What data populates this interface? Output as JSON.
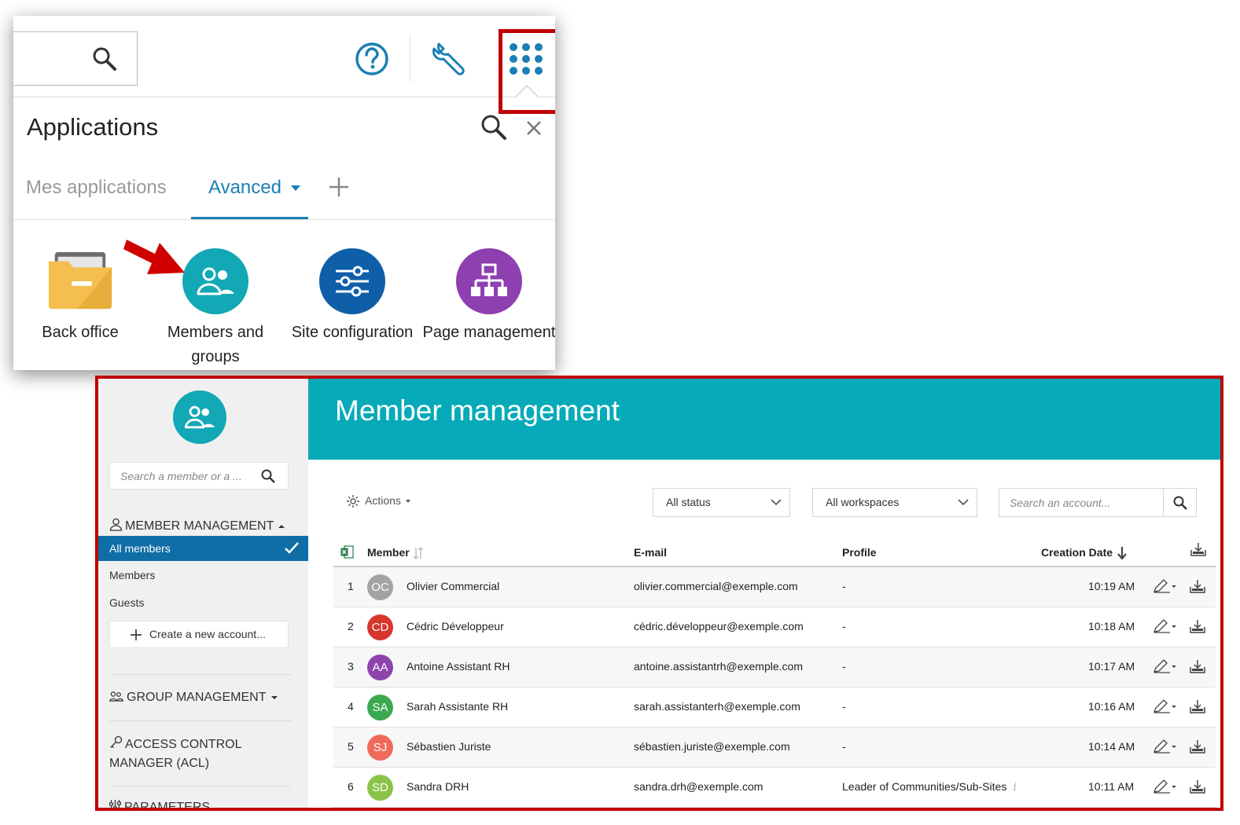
{
  "top_popup": {
    "search_icon": "search-icon",
    "help_icon": "help-circle-icon",
    "tools_icon": "wrench-icon",
    "apps_icon": "apps-grid-icon",
    "title": "Applications",
    "tabs": [
      {
        "label": "Mes applications",
        "active": false
      },
      {
        "label": "Avanced",
        "active": true
      }
    ],
    "add_tab_icon": "plus-icon",
    "applications": [
      {
        "label": "Back office",
        "icon": "folder-icon",
        "color": "#f1b53a"
      },
      {
        "label": "Members and groups",
        "icon": "people-icon",
        "color": "#12a8b5"
      },
      {
        "label": "Site configuration",
        "icon": "sliders-icon",
        "color": "#0f5ea8"
      },
      {
        "label": "Page management",
        "icon": "sitemap-icon",
        "color": "#8e3fb0"
      }
    ]
  },
  "member_mgmt": {
    "title": "Member management",
    "accent_color": "#07aab8",
    "sidebar": {
      "search_placeholder": "Search a member or a ...",
      "member_section": "MEMBER MANAGEMENT",
      "items": [
        {
          "label": "All members",
          "active": true
        },
        {
          "label": "Members",
          "active": false
        },
        {
          "label": "Guests",
          "active": false
        }
      ],
      "create_label": "Create a new account...",
      "group_section": "GROUP MANAGEMENT",
      "acl_section": "ACCESS CONTROL MANAGER (ACL)",
      "params_section": "PARAMETERS"
    },
    "toolbar": {
      "actions_label": "Actions",
      "status_filter": "All status",
      "workspace_filter": "All workspaces",
      "search_placeholder": "Search an account..."
    },
    "table": {
      "columns": {
        "member": "Member",
        "email": "E-mail",
        "profile": "Profile",
        "date": "Creation Date"
      },
      "rows": [
        {
          "num": "1",
          "initials": "OC",
          "color": "#a3a3a3",
          "name": "Olivier Commercial",
          "email": "olivier.commercial@exemple.com",
          "profile": "-",
          "info": "",
          "time": "10:19 AM"
        },
        {
          "num": "2",
          "initials": "CD",
          "color": "#d8352c",
          "name": "Cédric Développeur",
          "email": "cédric.développeur@exemple.com",
          "profile": "-",
          "info": "",
          "time": "10:18 AM"
        },
        {
          "num": "3",
          "initials": "AA",
          "color": "#8d44ad",
          "name": "Antoine Assistant RH",
          "email": "antoine.assistantrh@exemple.com",
          "profile": "-",
          "info": "",
          "time": "10:17 AM"
        },
        {
          "num": "4",
          "initials": "SA",
          "color": "#3aa84f",
          "name": "Sarah Assistante RH",
          "email": "sarah.assistanterh@exemple.com",
          "profile": "-",
          "info": "",
          "time": "10:16 AM"
        },
        {
          "num": "5",
          "initials": "SJ",
          "color": "#ef6a5a",
          "name": "Sébastien Juriste",
          "email": "sébastien.juriste@exemple.com",
          "profile": "-",
          "info": "",
          "time": "10:14 AM"
        },
        {
          "num": "6",
          "initials": "SD",
          "color": "#8bc34a",
          "name": "Sandra DRH",
          "email": "sandra.drh@exemple.com",
          "profile": "Leader of Communities/Sub-Sites",
          "info": "i",
          "time": "10:11 AM"
        }
      ]
    }
  }
}
